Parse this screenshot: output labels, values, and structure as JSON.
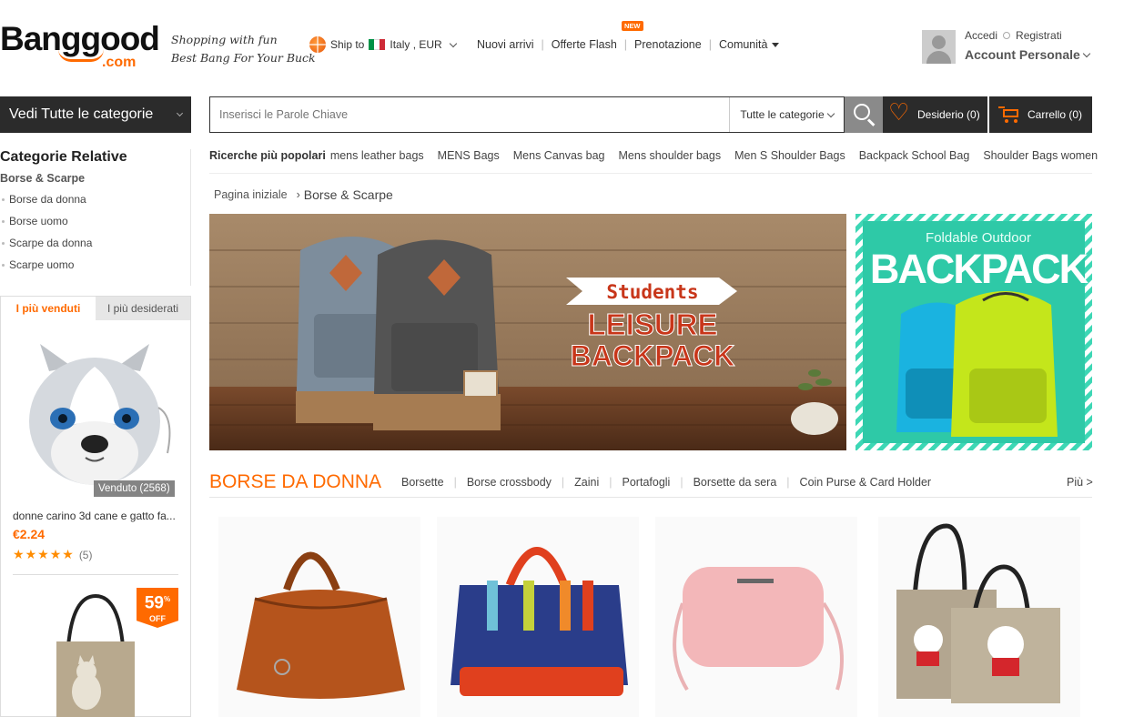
{
  "header": {
    "logo_main": "Banggood",
    "logo_com": ".com",
    "slogan_1": "Shopping with fun",
    "slogan_2": "Best Bang For Your Buck",
    "ship_label": "Ship to",
    "ship_country": "Italy , EUR",
    "nav": [
      "Nuovi arrivi",
      "Offerte Flash",
      "Prenotazione",
      "Comunità"
    ],
    "new_badge": "NEW",
    "login": "Accedi",
    "register": "Registrati",
    "account": "Account Personale"
  },
  "search": {
    "all_categories_button": "Vedi Tutte le categorie",
    "placeholder": "Inserisci le Parole Chiave",
    "category_select": "Tutte le categorie",
    "wishlist": "Desiderio (0)",
    "cart": "Carrello (0)"
  },
  "sidebar": {
    "title": "Categorie Relative",
    "subtitle": "Borse & Scarpe",
    "items": [
      "Borse da donna",
      "Borse uomo",
      "Scarpe da donna",
      "Scarpe uomo"
    ],
    "tabs": [
      "I più venduti",
      "I più desiderati"
    ],
    "product": {
      "sold": "Venduto (2568)",
      "name": "donne carino 3d cane e gatto fa...",
      "price": "€2.24",
      "reviews": "(5)",
      "rating": 5
    },
    "product2_discount": "59",
    "discount_percent": "%",
    "discount_off": "OFF"
  },
  "popular": {
    "label": "Ricerche più popolari",
    "terms": [
      "mens leather bags",
      "MENS Bags",
      "Mens Canvas bag",
      "Mens shoulder bags",
      "Men S Shoulder Bags",
      "Backpack School Bag",
      "Shoulder Bags women"
    ]
  },
  "breadcrumb": {
    "home": "Pagina iniziale",
    "sep": "›",
    "current": "Borse & Scarpe"
  },
  "banner_main": {
    "line1": "Students",
    "line2": "LEISURE",
    "line3": "BACKPACK"
  },
  "banner_side": {
    "line1": "Foldable Outdoor",
    "line2": "BACKPACK"
  },
  "section": {
    "title": "BORSE DA DONNA",
    "tabs": [
      "Borsette",
      "Borse crossbody",
      "Zaini",
      "Portafogli",
      "Borsette da sera",
      "Coin Purse & Card Holder"
    ],
    "more": "Più >"
  },
  "colors": {
    "accent": "#ff6a00",
    "dark_bar": "#2b2b2b"
  }
}
